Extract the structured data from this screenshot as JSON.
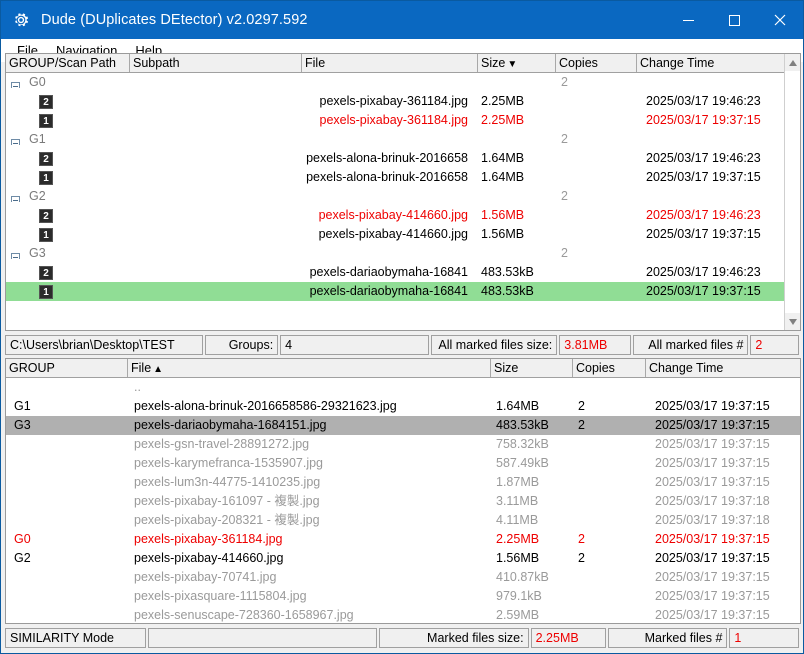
{
  "window": {
    "title": "Dude (DUplicates DEtector) v2.0297.592",
    "icon": "gear-icon",
    "minimize_label": "–",
    "maximize_label": "☐",
    "close_label": "✕",
    "accent_color": "#0a68c1"
  },
  "menubar": {
    "items": [
      {
        "label": "File"
      },
      {
        "label": "Navigation"
      },
      {
        "label": "Help"
      }
    ]
  },
  "groups_panel": {
    "columns": [
      {
        "label": "GROUP/Scan Path",
        "sort": ""
      },
      {
        "label": "Subpath",
        "sort": ""
      },
      {
        "label": "File",
        "sort": ""
      },
      {
        "label": "Size",
        "sort": "▼"
      },
      {
        "label": "Copies",
        "sort": ""
      },
      {
        "label": "Change Time",
        "sort": ""
      }
    ],
    "rows": [
      {
        "kind": "group",
        "group": "G0",
        "copies": "2",
        "file": "",
        "size": "",
        "time": "",
        "color": "gray",
        "selected": "none"
      },
      {
        "kind": "file",
        "marker": "2",
        "file": "pexels-pixabay-361184.jpg",
        "size": "2.25MB",
        "copies": "",
        "time": "2025/03/17 19:46:23",
        "color": "black",
        "selected": "none"
      },
      {
        "kind": "file",
        "marker": "1",
        "file": "pexels-pixabay-361184.jpg",
        "size": "2.25MB",
        "copies": "",
        "time": "2025/03/17 19:37:15",
        "color": "red",
        "selected": "none"
      },
      {
        "kind": "group",
        "group": "G1",
        "copies": "2",
        "file": "",
        "size": "",
        "time": "",
        "color": "gray",
        "selected": "none"
      },
      {
        "kind": "file",
        "marker": "2",
        "file": "pexels-alona-brinuk-2016658",
        "size": "1.64MB",
        "copies": "",
        "time": "2025/03/17 19:46:23",
        "color": "black",
        "selected": "none"
      },
      {
        "kind": "file",
        "marker": "1",
        "file": "pexels-alona-brinuk-2016658",
        "size": "1.64MB",
        "copies": "",
        "time": "2025/03/17 19:37:15",
        "color": "black",
        "selected": "none"
      },
      {
        "kind": "group",
        "group": "G2",
        "copies": "2",
        "file": "",
        "size": "",
        "time": "",
        "color": "gray",
        "selected": "none"
      },
      {
        "kind": "file",
        "marker": "2",
        "file": "pexels-pixabay-414660.jpg",
        "size": "1.56MB",
        "copies": "",
        "time": "2025/03/17 19:46:23",
        "color": "red",
        "selected": "none"
      },
      {
        "kind": "file",
        "marker": "1",
        "file": "pexels-pixabay-414660.jpg",
        "size": "1.56MB",
        "copies": "",
        "time": "2025/03/17 19:37:15",
        "color": "black",
        "selected": "none"
      },
      {
        "kind": "group",
        "group": "G3",
        "copies": "2",
        "file": "",
        "size": "",
        "time": "",
        "color": "gray",
        "selected": "none"
      },
      {
        "kind": "file",
        "marker": "2",
        "file": "pexels-dariaobymaha-16841\u0015",
        "size": "483.53kB",
        "copies": "",
        "time": "2025/03/17 19:46:23",
        "color": "black",
        "selected": "none"
      },
      {
        "kind": "file",
        "marker": "1",
        "file": "pexels-dariaobymaha-16841\u0015",
        "size": "483.53kB",
        "copies": "",
        "time": "2025/03/17 19:37:15",
        "color": "black",
        "selected": "green"
      }
    ]
  },
  "upper_status": {
    "scan_path": "C:\\Users\\brian\\Desktop\\TEST",
    "groups_label": "Groups:",
    "groups_value": "4",
    "marked_size_label": "All marked files size:",
    "marked_size_value": "3.81MB",
    "marked_count_label": "All marked files #",
    "marked_count_value": "2"
  },
  "files_panel": {
    "columns": [
      {
        "label": "GROUP",
        "sort": ""
      },
      {
        "label": "File",
        "sort": "▲"
      },
      {
        "label": "Size",
        "sort": ""
      },
      {
        "label": "Copies",
        "sort": ""
      },
      {
        "label": "Change Time",
        "sort": ""
      }
    ],
    "rows": [
      {
        "group": "",
        "file": "..",
        "size": "",
        "copies": "",
        "time": "",
        "color": "gray",
        "selected": "none"
      },
      {
        "group": "G1",
        "file": "pexels-alona-brinuk-2016658586-29321623.jpg",
        "size": "1.64MB",
        "copies": "2",
        "time": "2025/03/17 19:37:15",
        "color": "black",
        "selected": "none"
      },
      {
        "group": "G3",
        "file": "pexels-dariaobymaha-1684151.jpg",
        "size": "483.53kB",
        "copies": "2",
        "time": "2025/03/17 19:37:15",
        "color": "black",
        "selected": "gray"
      },
      {
        "group": "",
        "file": "pexels-gsn-travel-28891272.jpg",
        "size": "758.32kB",
        "copies": "",
        "time": "2025/03/17 19:37:15",
        "color": "gray",
        "selected": "none"
      },
      {
        "group": "",
        "file": "pexels-karymefranca-1535907.jpg",
        "size": "587.49kB",
        "copies": "",
        "time": "2025/03/17 19:37:15",
        "color": "gray",
        "selected": "none"
      },
      {
        "group": "",
        "file": "pexels-lum3n-44775-1410235.jpg",
        "size": "1.87MB",
        "copies": "",
        "time": "2025/03/17 19:37:15",
        "color": "gray",
        "selected": "none"
      },
      {
        "group": "",
        "file": "pexels-pixabay-161097 - 複製.jpg",
        "size": "3.11MB",
        "copies": "",
        "time": "2025/03/17 19:37:18",
        "color": "gray",
        "selected": "none"
      },
      {
        "group": "",
        "file": "pexels-pixabay-208321 - 複製.jpg",
        "size": "4.11MB",
        "copies": "",
        "time": "2025/03/17 19:37:18",
        "color": "gray",
        "selected": "none"
      },
      {
        "group": "G0",
        "file": "pexels-pixabay-361184.jpg",
        "size": "2.25MB",
        "copies": "2",
        "time": "2025/03/17 19:37:15",
        "color": "red",
        "selected": "none"
      },
      {
        "group": "G2",
        "file": "pexels-pixabay-414660.jpg",
        "size": "1.56MB",
        "copies": "2",
        "time": "2025/03/17 19:37:15",
        "color": "black",
        "selected": "none"
      },
      {
        "group": "",
        "file": "pexels-pixabay-70741.jpg",
        "size": "410.87kB",
        "copies": "",
        "time": "2025/03/17 19:37:15",
        "color": "gray",
        "selected": "none"
      },
      {
        "group": "",
        "file": "pexels-pixasquare-1115804.jpg",
        "size": "979.1kB",
        "copies": "",
        "time": "2025/03/17 19:37:15",
        "color": "gray",
        "selected": "none"
      },
      {
        "group": "",
        "file": "pexels-senuscape-728360-1658967.jpg",
        "size": "2.59MB",
        "copies": "",
        "time": "2025/03/17 19:37:15",
        "color": "gray",
        "selected": "none"
      }
    ]
  },
  "lower_status": {
    "mode": "SIMILARITY Mode",
    "spacer": "",
    "marked_size_label": "Marked files size:",
    "marked_size_value": "2.25MB",
    "marked_count_label": "Marked files #",
    "marked_count_value": "1"
  },
  "colors": {
    "accent": "#0a68c1",
    "marked_red": "#ee0000",
    "selection_green": "#90dd95",
    "selection_gray": "#b0b0b0"
  }
}
